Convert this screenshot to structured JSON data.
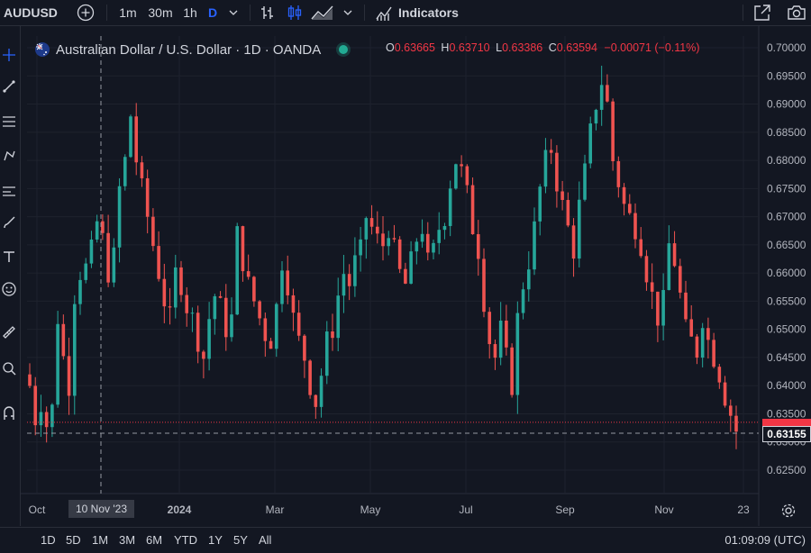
{
  "toolbar": {
    "symbol": "AUDUSD",
    "intervals": [
      "1m",
      "30m",
      "1h",
      "D"
    ],
    "active_interval": "D",
    "indicators_label": "Indicators"
  },
  "legend": {
    "title": "Australian Dollar / U.S. Dollar · 1D · OANDA",
    "o_key": "O",
    "o_val": "0.63665",
    "h_key": "H",
    "h_val": "0.63710",
    "l_key": "L",
    "l_val": "0.63386",
    "c_key": "C",
    "c_val": "0.63594",
    "change": "−0.00071 (−0.11%)"
  },
  "price_axis": {
    "labels": [
      "0.70000",
      "0.69500",
      "0.69000",
      "0.68500",
      "0.68000",
      "0.67500",
      "0.67000",
      "0.66500",
      "0.66000",
      "0.65500",
      "0.65000",
      "0.64500",
      "0.64000",
      "0.63500",
      "0.63000",
      "0.62500"
    ],
    "current_price": "0.63155"
  },
  "time_axis": {
    "labels": [
      "Oct",
      "2024",
      "Mar",
      "May",
      "Jul",
      "Sep",
      "Nov",
      "23"
    ],
    "crosshair_date": "10 Nov '23"
  },
  "ranges": [
    "1D",
    "5D",
    "1M",
    "3M",
    "6M",
    "YTD",
    "1Y",
    "5Y",
    "All"
  ],
  "clock": "01:09:09 (UTC)",
  "colors": {
    "up": "#26a69a",
    "down": "#ef5350",
    "background": "#131722",
    "accent": "#2962ff",
    "last_price": "#f23645"
  },
  "chart_data": {
    "type": "candlestick",
    "title": "Australian Dollar / U.S. Dollar · 1D · OANDA",
    "ylim": [
      0.623,
      0.702
    ],
    "x_labels": [
      "Oct",
      "2024",
      "Mar",
      "May",
      "Jul",
      "Sep",
      "Nov",
      "23"
    ],
    "close_path": [
      0.64,
      0.634,
      0.637,
      0.633,
      0.636,
      0.652,
      0.645,
      0.64,
      0.656,
      0.66,
      0.661,
      0.664,
      0.669,
      0.666,
      0.66,
      0.663,
      0.675,
      0.68,
      0.688,
      0.68,
      0.675,
      0.67,
      0.665,
      0.66,
      0.655,
      0.652,
      0.66,
      0.658,
      0.654,
      0.652,
      0.648,
      0.645,
      0.652,
      0.656,
      0.654,
      0.65,
      0.652,
      0.667,
      0.662,
      0.658,
      0.655,
      0.652,
      0.649,
      0.648,
      0.654,
      0.662,
      0.658,
      0.652,
      0.648,
      0.645,
      0.64,
      0.637,
      0.642,
      0.648,
      0.65,
      0.656,
      0.66,
      0.658,
      0.662,
      0.664,
      0.67,
      0.668,
      0.666,
      0.665,
      0.668,
      0.664,
      0.66,
      0.658,
      0.662,
      0.666,
      0.668,
      0.662,
      0.664,
      0.668,
      0.67,
      0.676,
      0.68,
      0.678,
      0.674,
      0.668,
      0.664,
      0.655,
      0.648,
      0.645,
      0.65,
      0.645,
      0.64,
      0.652,
      0.658,
      0.662,
      0.668,
      0.675,
      0.68,
      0.682,
      0.676,
      0.672,
      0.668,
      0.664,
      0.672,
      0.678,
      0.685,
      0.69,
      0.694,
      0.69,
      0.68,
      0.676,
      0.672,
      0.67,
      0.668,
      0.665,
      0.66,
      0.656,
      0.652,
      0.655,
      0.665,
      0.662,
      0.656,
      0.65,
      0.648,
      0.646,
      0.652,
      0.648,
      0.645,
      0.642,
      0.638,
      0.635,
      0.632
    ]
  }
}
